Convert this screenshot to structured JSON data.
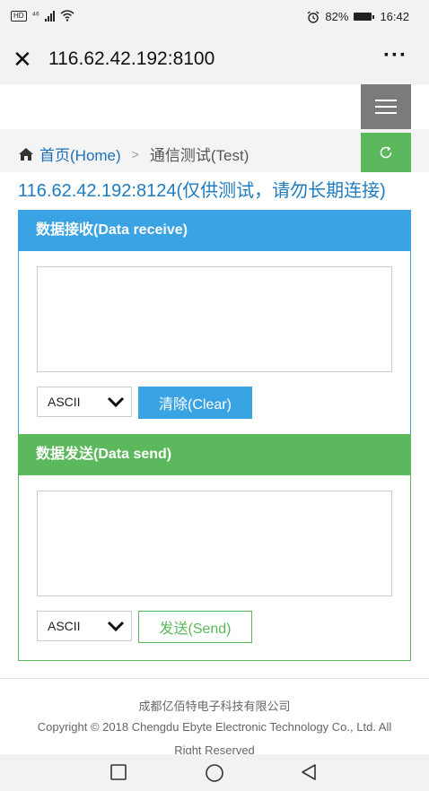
{
  "status_bar": {
    "hd_badge": "HD",
    "network": "⁴⁶",
    "battery_percent": "82%",
    "time": "16:42"
  },
  "browser": {
    "close_glyph": "✕",
    "url": "116.62.42.192:8100",
    "more_glyph": "···"
  },
  "breadcrumb": {
    "home_label": "首页(Home)",
    "separator": ">",
    "current_label": "通信测试(Test)"
  },
  "server_info": "116.62.42.192:8124(仅供测试，请勿长期连接)",
  "receive_panel": {
    "title": "数据接收(Data receive)",
    "textarea_value": "",
    "format_selected": "ASCII",
    "clear_label": "清除(Clear)"
  },
  "send_panel": {
    "title": "数据发送(Data send)",
    "textarea_value": "",
    "format_selected": "ASCII",
    "send_label": "发送(Send)"
  },
  "footer": {
    "company": "成都亿佰特电子科技有限公司",
    "copyright": "Copyright © 2018 Chengdu Ebyte Electronic Technology Co., Ltd. All",
    "reserved": "Right Reserved"
  },
  "colors": {
    "blue_accent": "#3aa3e3",
    "green_accent": "#5cb85c",
    "link_blue": "#1f6fb5",
    "menu_gray": "#7b7b7b"
  }
}
